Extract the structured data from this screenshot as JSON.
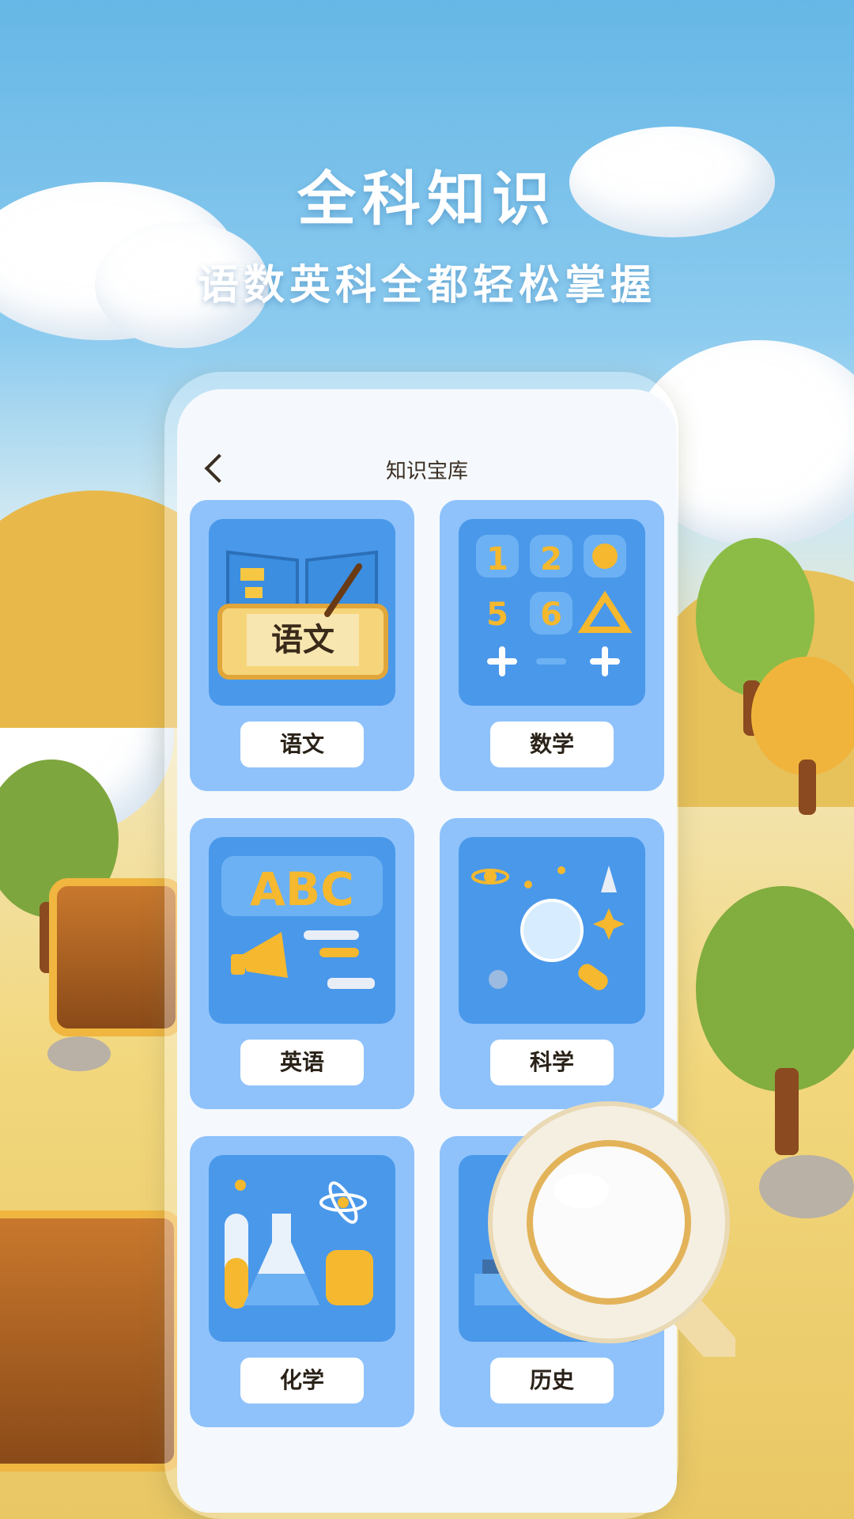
{
  "promo": {
    "title": "全科知识",
    "subtitle": "语数英科全都轻松掌握"
  },
  "nav": {
    "title": "知识宝库"
  },
  "subjects": [
    {
      "label": "语文",
      "art_text": "语文"
    },
    {
      "label": "数学",
      "art_digits": [
        "1",
        "2",
        "5",
        "6"
      ]
    },
    {
      "label": "英语",
      "art_text": "ABC"
    },
    {
      "label": "科学"
    },
    {
      "label": "化学"
    },
    {
      "label": "历史"
    }
  ],
  "colors": {
    "card_bg": "#8fc2fb",
    "card_art_bg": "#4a98ea",
    "accent_gold": "#f5b82e",
    "label_bg": "#ffffff"
  }
}
